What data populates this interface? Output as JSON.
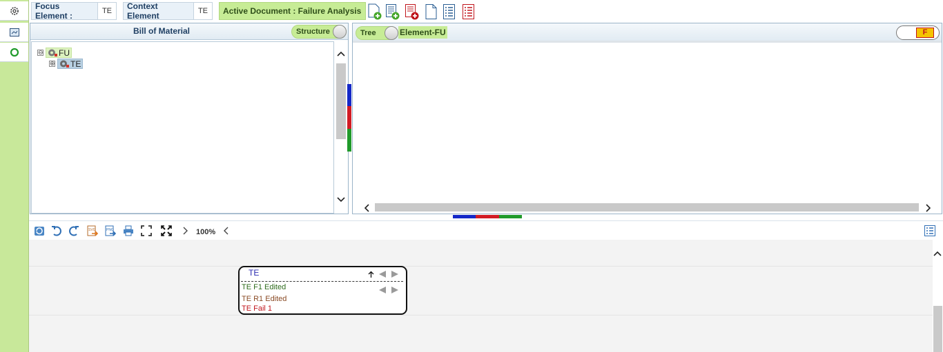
{
  "rail": {
    "items": [
      "gear-icon",
      "panel-icon",
      "refresh-icon"
    ]
  },
  "toolbar": {
    "focus_label": "Focus Element :",
    "focus_value": "TE",
    "context_label": "Context Element",
    "context_value": "TE",
    "active_doc": "Active Document : Failure Analysis",
    "icons": [
      "add-document-icon",
      "add-list-icon",
      "delete-list-icon",
      "blank-document-icon",
      "list-document-icon",
      "red-list-document-icon"
    ]
  },
  "bom": {
    "title": "Bill of Material",
    "toggle_label": "Structure",
    "tree": [
      {
        "label": "FU",
        "expander": "⊖"
      },
      {
        "label": "TE",
        "expander": "⊕"
      }
    ]
  },
  "right_panel": {
    "toggle_label": "Tree",
    "element_label": "Element-FU",
    "f_badge": "F"
  },
  "diagram_toolbar": {
    "zoom": "100%",
    "icons": [
      "refresh-icon",
      "undo-icon",
      "redo-icon",
      "export-svg-icon",
      "export-png-icon",
      "print-icon",
      "fit-screen-icon",
      "expand-icon"
    ]
  },
  "card": {
    "title": "TE",
    "rows": [
      {
        "text": "TE F1 Edited",
        "color": "#2e6b1c"
      },
      {
        "text": "TE R1 Edited",
        "color": "#8a4b25"
      },
      {
        "text": "TE Fail 1",
        "color": "#c0141b"
      }
    ]
  },
  "colors": {
    "accent_green": "#c7ec96",
    "blue": "#1428c8",
    "red": "#d21b24",
    "green": "#1f9a2a"
  }
}
